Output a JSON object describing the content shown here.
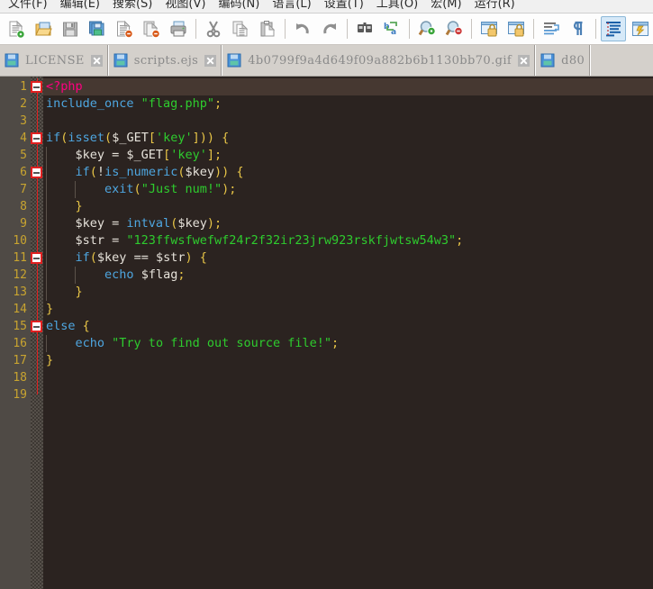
{
  "menu": {
    "items": [
      {
        "label": "文件(F)"
      },
      {
        "label": "编辑(E)"
      },
      {
        "label": "搜索(S)"
      },
      {
        "label": "视图(V)"
      },
      {
        "label": "编码(N)"
      },
      {
        "label": "语言(L)"
      },
      {
        "label": "设置(T)"
      },
      {
        "label": "工具(O)"
      },
      {
        "label": "宏(M)"
      },
      {
        "label": "运行(R)"
      }
    ]
  },
  "toolbar": {
    "buttons": [
      {
        "icon": "new-file-icon",
        "name": "new-file-button"
      },
      {
        "icon": "open-file-icon",
        "name": "open-file-button"
      },
      {
        "icon": "save-icon",
        "name": "save-button"
      },
      {
        "icon": "save-all-icon",
        "name": "save-all-button"
      },
      {
        "icon": "close-file-icon",
        "name": "close-file-button"
      },
      {
        "icon": "close-all-icon",
        "name": "close-all-button"
      },
      {
        "icon": "print-icon",
        "name": "print-button"
      },
      {
        "icon": "separator",
        "name": "toolbar-separator-1"
      },
      {
        "icon": "cut-icon",
        "name": "cut-button"
      },
      {
        "icon": "copy-icon",
        "name": "copy-button"
      },
      {
        "icon": "paste-icon",
        "name": "paste-button"
      },
      {
        "icon": "separator",
        "name": "toolbar-separator-2"
      },
      {
        "icon": "undo-icon",
        "name": "undo-button"
      },
      {
        "icon": "redo-icon",
        "name": "redo-button"
      },
      {
        "icon": "separator",
        "name": "toolbar-separator-3"
      },
      {
        "icon": "find-icon",
        "name": "find-button"
      },
      {
        "icon": "replace-icon",
        "name": "replace-button"
      },
      {
        "icon": "separator",
        "name": "toolbar-separator-4"
      },
      {
        "icon": "zoom-in-icon",
        "name": "zoom-in-button"
      },
      {
        "icon": "zoom-out-icon",
        "name": "zoom-out-button"
      },
      {
        "icon": "separator",
        "name": "toolbar-separator-5"
      },
      {
        "icon": "sync-vertical-scroll-icon",
        "name": "sync-vertical-scroll-button"
      },
      {
        "icon": "sync-horizontal-scroll-icon",
        "name": "sync-horizontal-scroll-button"
      },
      {
        "icon": "separator",
        "name": "toolbar-separator-6"
      },
      {
        "icon": "word-wrap-icon",
        "name": "word-wrap-button"
      },
      {
        "icon": "show-all-chars-icon",
        "name": "show-all-characters-button"
      },
      {
        "icon": "separator",
        "name": "toolbar-separator-7"
      },
      {
        "icon": "indent-guide-icon",
        "name": "indent-guideline-button"
      },
      {
        "icon": "user-defined-dialog-icon",
        "name": "user-defined-dialog-button"
      }
    ]
  },
  "tabs": [
    {
      "label": "LICENSE",
      "active": false
    },
    {
      "label": "scripts.ejs",
      "active": false
    },
    {
      "label": "4b0799f9a4d649f09a882b6b1130bb70.gif",
      "active": false
    },
    {
      "label": "d80",
      "active": true
    }
  ],
  "editor": {
    "current_line": 1,
    "line_numbers": [
      "1",
      "2",
      "3",
      "4",
      "5",
      "6",
      "7",
      "8",
      "9",
      "10",
      "11",
      "12",
      "13",
      "14",
      "15",
      "16",
      "17",
      "18",
      "19"
    ],
    "lines": [
      {
        "n": "1",
        "indent": 0,
        "fold": "open",
        "tokens": [
          {
            "t": "<?php",
            "c": "t-php"
          }
        ]
      },
      {
        "n": "2",
        "indent": 0,
        "fold": "none",
        "tokens": [
          {
            "t": "include_once ",
            "c": "t-kw"
          },
          {
            "t": "\"flag.php\"",
            "c": "t-str"
          },
          {
            "t": ";",
            "c": "t-punc"
          }
        ]
      },
      {
        "n": "3",
        "indent": 0,
        "fold": "none",
        "tokens": []
      },
      {
        "n": "4",
        "indent": 0,
        "fold": "open",
        "tokens": [
          {
            "t": "if",
            "c": "t-kw"
          },
          {
            "t": "(",
            "c": "t-punc"
          },
          {
            "t": "isset",
            "c": "t-fn"
          },
          {
            "t": "(",
            "c": "t-punc"
          },
          {
            "t": "$_GET",
            "c": "t-var"
          },
          {
            "t": "[",
            "c": "t-punc"
          },
          {
            "t": "'key'",
            "c": "t-str"
          },
          {
            "t": "]))",
            "c": "t-punc"
          },
          {
            "t": " ",
            "c": "t-plain"
          },
          {
            "t": "{",
            "c": "t-punc"
          }
        ]
      },
      {
        "n": "5",
        "indent": 1,
        "fold": "none",
        "tokens": [
          {
            "t": "    ",
            "c": "t-plain"
          },
          {
            "t": "$key",
            "c": "t-var"
          },
          {
            "t": " = ",
            "c": "t-op"
          },
          {
            "t": "$_GET",
            "c": "t-var"
          },
          {
            "t": "[",
            "c": "t-punc"
          },
          {
            "t": "'key'",
            "c": "t-str"
          },
          {
            "t": "]",
            "c": "t-punc"
          },
          {
            "t": ";",
            "c": "t-punc"
          }
        ]
      },
      {
        "n": "6",
        "indent": 1,
        "fold": "open",
        "tokens": [
          {
            "t": "    ",
            "c": "t-plain"
          },
          {
            "t": "if",
            "c": "t-kw"
          },
          {
            "t": "(",
            "c": "t-punc"
          },
          {
            "t": "!",
            "c": "t-op"
          },
          {
            "t": "is_numeric",
            "c": "t-fn"
          },
          {
            "t": "(",
            "c": "t-punc"
          },
          {
            "t": "$key",
            "c": "t-var"
          },
          {
            "t": "))",
            "c": "t-punc"
          },
          {
            "t": " ",
            "c": "t-plain"
          },
          {
            "t": "{",
            "c": "t-punc"
          }
        ]
      },
      {
        "n": "7",
        "indent": 2,
        "fold": "none",
        "tokens": [
          {
            "t": "        ",
            "c": "t-plain"
          },
          {
            "t": "exit",
            "c": "t-kw"
          },
          {
            "t": "(",
            "c": "t-punc"
          },
          {
            "t": "\"Just num!\"",
            "c": "t-str"
          },
          {
            "t": ")",
            "c": "t-punc"
          },
          {
            "t": ";",
            "c": "t-punc"
          }
        ]
      },
      {
        "n": "8",
        "indent": 1,
        "fold": "none",
        "tokens": [
          {
            "t": "    ",
            "c": "t-plain"
          },
          {
            "t": "}",
            "c": "t-punc"
          }
        ]
      },
      {
        "n": "9",
        "indent": 1,
        "fold": "none",
        "tokens": [
          {
            "t": "    ",
            "c": "t-plain"
          },
          {
            "t": "$key",
            "c": "t-var"
          },
          {
            "t": " = ",
            "c": "t-op"
          },
          {
            "t": "intval",
            "c": "t-fn"
          },
          {
            "t": "(",
            "c": "t-punc"
          },
          {
            "t": "$key",
            "c": "t-var"
          },
          {
            "t": ")",
            "c": "t-punc"
          },
          {
            "t": ";",
            "c": "t-punc"
          }
        ]
      },
      {
        "n": "10",
        "indent": 1,
        "fold": "none",
        "tokens": [
          {
            "t": "    ",
            "c": "t-plain"
          },
          {
            "t": "$str",
            "c": "t-var"
          },
          {
            "t": " = ",
            "c": "t-op"
          },
          {
            "t": "\"123ffwsfwefwf24r2f32ir23jrw923rskfjwtsw54w3\"",
            "c": "t-str"
          },
          {
            "t": ";",
            "c": "t-punc"
          }
        ]
      },
      {
        "n": "11",
        "indent": 1,
        "fold": "open",
        "tokens": [
          {
            "t": "    ",
            "c": "t-plain"
          },
          {
            "t": "if",
            "c": "t-kw"
          },
          {
            "t": "(",
            "c": "t-punc"
          },
          {
            "t": "$key",
            "c": "t-var"
          },
          {
            "t": " == ",
            "c": "t-op"
          },
          {
            "t": "$str",
            "c": "t-var"
          },
          {
            "t": ")",
            "c": "t-punc"
          },
          {
            "t": " ",
            "c": "t-plain"
          },
          {
            "t": "{",
            "c": "t-punc"
          }
        ]
      },
      {
        "n": "12",
        "indent": 2,
        "fold": "none",
        "tokens": [
          {
            "t": "        ",
            "c": "t-plain"
          },
          {
            "t": "echo",
            "c": "t-kw"
          },
          {
            "t": " ",
            "c": "t-plain"
          },
          {
            "t": "$flag",
            "c": "t-var"
          },
          {
            "t": ";",
            "c": "t-punc"
          }
        ]
      },
      {
        "n": "13",
        "indent": 1,
        "fold": "none",
        "tokens": [
          {
            "t": "    ",
            "c": "t-plain"
          },
          {
            "t": "}",
            "c": "t-punc"
          }
        ]
      },
      {
        "n": "14",
        "indent": 0,
        "fold": "none",
        "tokens": [
          {
            "t": "}",
            "c": "t-punc"
          }
        ]
      },
      {
        "n": "15",
        "indent": 0,
        "fold": "open",
        "tokens": [
          {
            "t": "else",
            "c": "t-kw"
          },
          {
            "t": " ",
            "c": "t-plain"
          },
          {
            "t": "{",
            "c": "t-punc"
          }
        ]
      },
      {
        "n": "16",
        "indent": 1,
        "fold": "none",
        "tokens": [
          {
            "t": "    ",
            "c": "t-plain"
          },
          {
            "t": "echo",
            "c": "t-kw"
          },
          {
            "t": " ",
            "c": "t-plain"
          },
          {
            "t": "\"Try to find out source file!\"",
            "c": "t-str"
          },
          {
            "t": ";",
            "c": "t-punc"
          }
        ]
      },
      {
        "n": "17",
        "indent": 0,
        "fold": "none",
        "tokens": [
          {
            "t": "}",
            "c": "t-punc"
          }
        ]
      },
      {
        "n": "18",
        "indent": 0,
        "fold": "none",
        "tokens": []
      },
      {
        "n": "19",
        "indent": 0,
        "fold": "none",
        "tokens": []
      }
    ]
  },
  "colors": {
    "editor_background": "#2b2320",
    "gutter_background": "#4f4a45",
    "line_number": "#c8a430",
    "current_line": "#463831",
    "keyword": "#4ea6e0",
    "string": "#2ecc2e",
    "punctuation": "#e8c547",
    "php_tag": "#ff0080",
    "variable": "#e6e2da",
    "fold_marker": "#e02020",
    "toolbar_background": "#fdfdfd",
    "tabbar_background": "#d4d0cb"
  }
}
